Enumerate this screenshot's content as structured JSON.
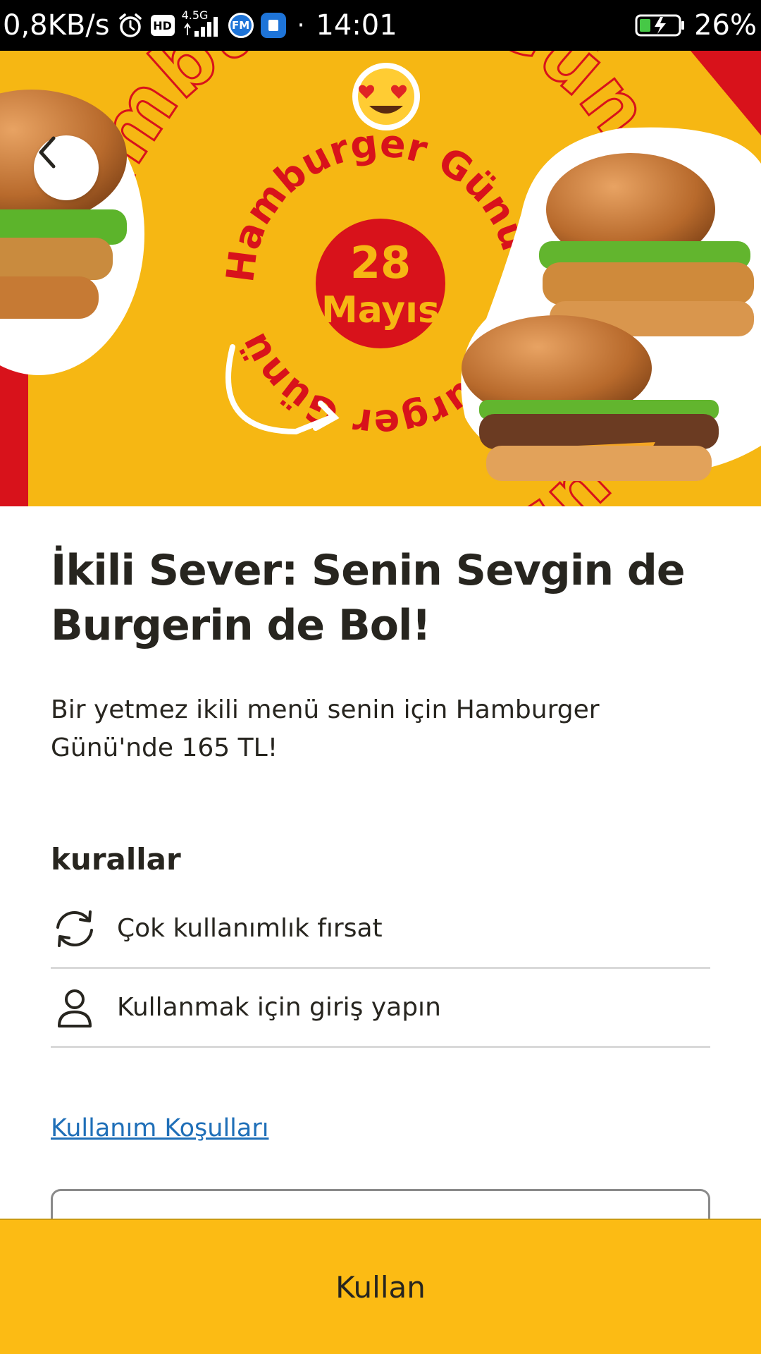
{
  "status_bar": {
    "net_speed": "0,8KB/s",
    "hd_badge": "HD",
    "network_type": "4.5G",
    "fm_app_badge": "FM",
    "time": "14:01",
    "battery": "26%",
    "icons": [
      "alarm-icon",
      "hd-icon",
      "signal-icon",
      "fm-app-icon",
      "notes-app-icon",
      "battery-charging-icon"
    ]
  },
  "hero": {
    "badge_day": "28",
    "badge_month": "Mayıs",
    "ring_text": "Hamburger Günü Hamburger Günü",
    "outer_text": "Hamburger Günü Hamburger",
    "colors": {
      "background": "#f6b713",
      "accent": "#d8121b"
    }
  },
  "offer": {
    "title": "İkili Sever: Senin Sevgin de Burgerin de Bol!",
    "description": "Bir yetmez ikili menü senin için Hamburger Günü'nde 165 TL!"
  },
  "rules": {
    "heading": "kurallar",
    "items": [
      {
        "icon": "refresh-icon",
        "label": "Çok kullanımlık fırsat"
      },
      {
        "icon": "user-icon",
        "label": "Kullanmak için giriş yapın"
      }
    ]
  },
  "terms_link": "Kullanım Koşulları",
  "action_button": {
    "label": "Kullan",
    "color": "#fcbb14"
  }
}
